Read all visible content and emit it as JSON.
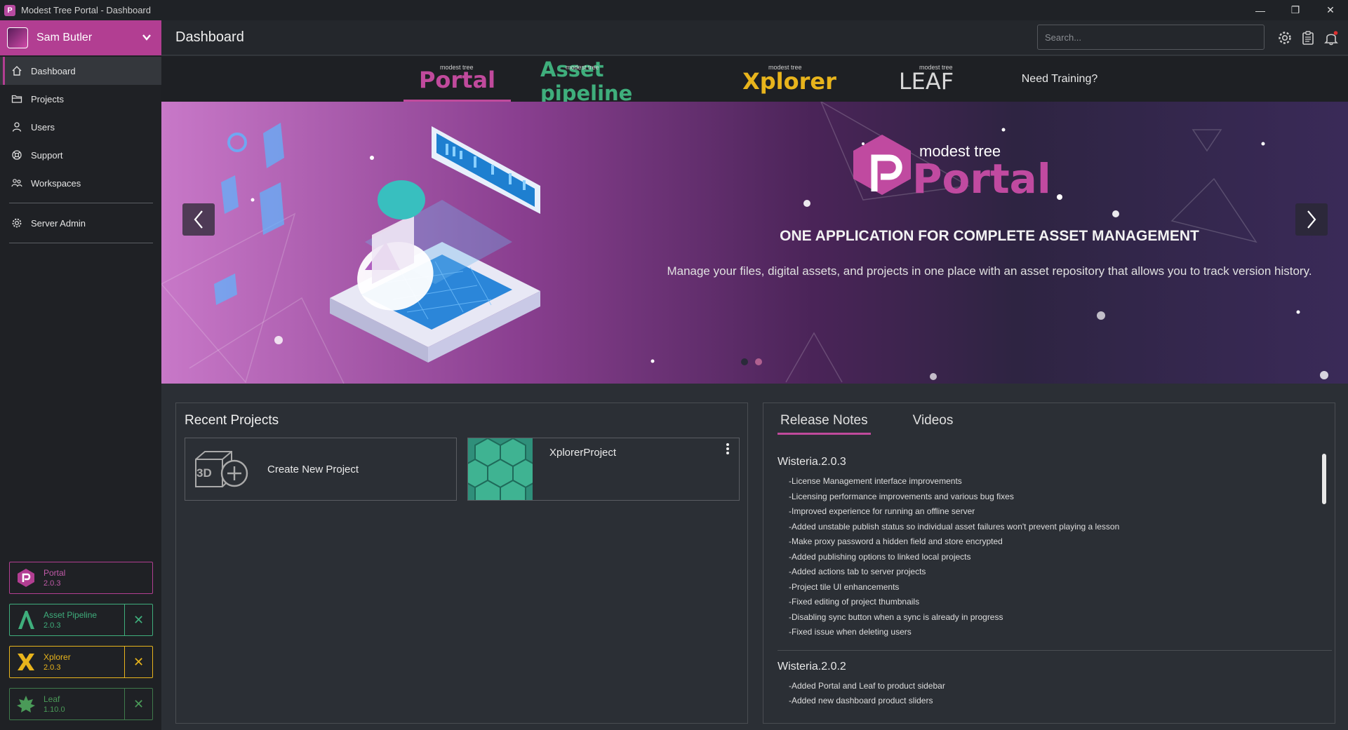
{
  "window": {
    "title": "Modest Tree Portal - Dashboard",
    "minimize": "—",
    "restore": "❐",
    "close": "✕"
  },
  "user": {
    "name": "Sam Butler"
  },
  "nav": [
    {
      "label": "Dashboard",
      "icon": "home-icon",
      "active": true
    },
    {
      "label": "Projects",
      "icon": "folder-icon"
    },
    {
      "label": "Users",
      "icon": "user-icon"
    },
    {
      "label": "Support",
      "icon": "lifebuoy-icon"
    },
    {
      "label": "Workspaces",
      "icon": "users-icon"
    },
    {
      "label": "Server Admin",
      "icon": "gear-icon"
    }
  ],
  "products": [
    {
      "name": "Portal",
      "version": "2.0.3",
      "color": "#b23e92"
    },
    {
      "name": "Asset Pipeline",
      "version": "2.0.3",
      "color": "#3fae7c"
    },
    {
      "name": "Xplorer",
      "version": "2.0.3",
      "color": "#e8b41c"
    },
    {
      "name": "Leaf",
      "version": "1.10.0",
      "color": "#4a9a58"
    }
  ],
  "header": {
    "title": "Dashboard",
    "search_placeholder": "Search..."
  },
  "product_tabs": {
    "small": "modest tree",
    "portal": "Portal",
    "asset_pipeline": "Asset pipeline",
    "xplorer": "Xplorer",
    "leaf": "LEAF",
    "training": "Need Training?"
  },
  "banner": {
    "logo_small": "modest tree",
    "logo_big": "Portal",
    "headline": "ONE APPLICATION FOR COMPLETE ASSET MANAGEMENT",
    "description": "Manage your files, digital assets, and projects in one place with an asset repository that allows you to track version history.",
    "slide_count": 2,
    "active_slide": 1
  },
  "recent": {
    "title": "Recent Projects",
    "create_label": "Create New Project",
    "create_icon_text": "3D",
    "projects": [
      {
        "name": "XplorerProject"
      }
    ]
  },
  "release": {
    "tabs": [
      "Release Notes",
      "Videos"
    ],
    "versions": [
      {
        "name": "Wisteria.2.0.3",
        "notes": [
          "-License Management interface improvements",
          "-Licensing performance improvements and various bug fixes",
          "-Improved experience for running an offline server",
          "-Added unstable publish status so individual asset failures won't prevent playing a lesson",
          "-Make proxy password a hidden field and store encrypted",
          "-Added publishing options to linked local projects",
          "-Added actions tab to server projects",
          "-Project tile UI enhancements",
          "-Fixed editing of project thumbnails",
          "-Disabling sync button when a sync is already in progress",
          "-Fixed issue when deleting users"
        ]
      },
      {
        "name": "Wisteria.2.0.2",
        "notes": [
          "-Added Portal and Leaf to product sidebar",
          "-Added new dashboard product sliders"
        ]
      }
    ]
  }
}
